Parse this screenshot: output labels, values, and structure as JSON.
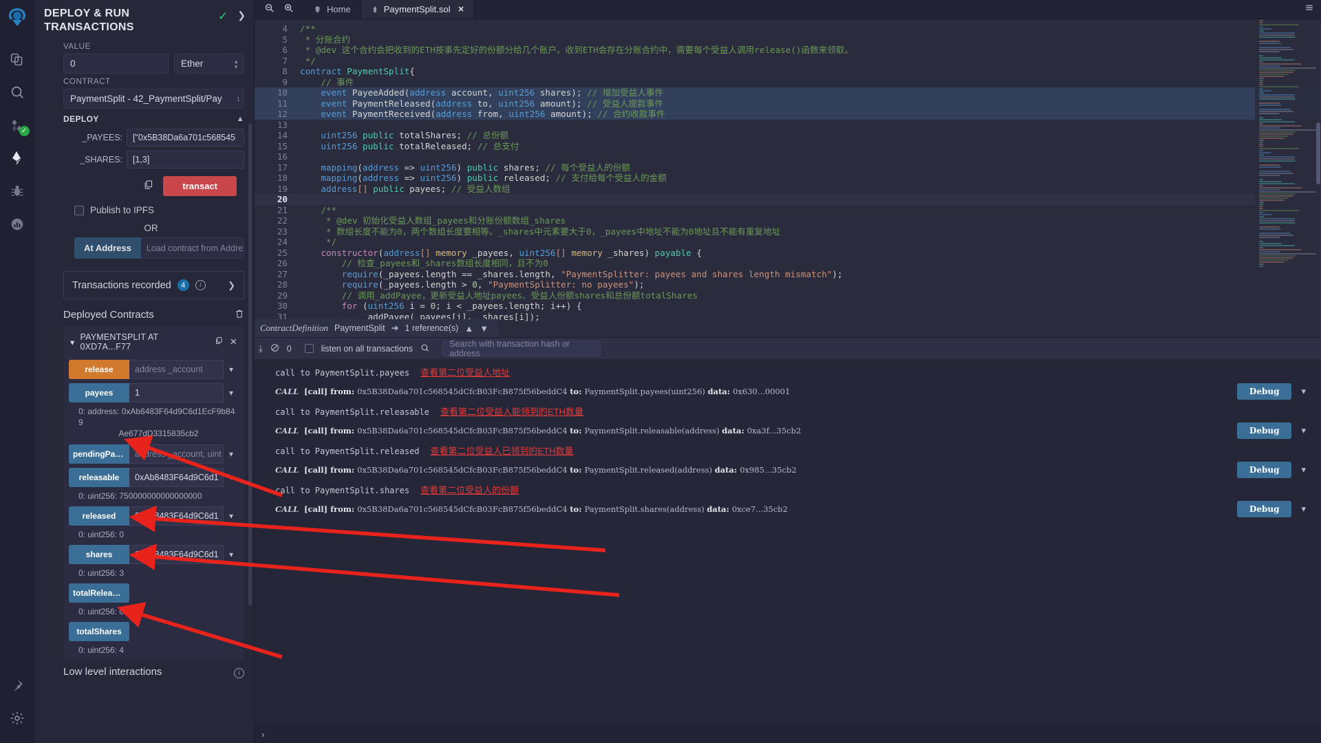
{
  "rail": {
    "logo": "remix-logo-icon",
    "items": [
      {
        "name": "file-explorer-icon"
      },
      {
        "name": "search-icon"
      },
      {
        "name": "solidity-compiler-icon",
        "badge": "✓"
      },
      {
        "name": "deploy-run-icon"
      },
      {
        "name": "debugger-icon"
      },
      {
        "name": "plugin-manager-icon"
      }
    ],
    "bottom": [
      {
        "name": "pin-icon"
      },
      {
        "name": "settings-gear-icon"
      }
    ]
  },
  "panel": {
    "title": "DEPLOY & RUN TRANSACTIONS",
    "value_label": "VALUE",
    "value": "0",
    "unit": "Ether",
    "contract_label": "CONTRACT",
    "contract": "PaymentSplit - 42_PaymentSplit/Pay",
    "deploy_label": "DEPLOY",
    "args": [
      {
        "label": "_PAYEES:",
        "value": "[\"0x5B38Da6a701c568545"
      },
      {
        "label": "_SHARES:",
        "value": "[1,3]"
      }
    ],
    "transact_label": "transact",
    "publish_ipfs": "Publish to IPFS",
    "or": "OR",
    "at_address_label": "At Address",
    "at_address_placeholder": "Load contract from Addre",
    "transactions_recorded": "Transactions recorded",
    "transactions_count": "4",
    "deployed_contracts": "Deployed Contracts",
    "contract_instance": "PAYMENTSPLIT AT 0XD7A...F77",
    "functions": [
      {
        "name": "release",
        "color": "orange",
        "input": "address _account",
        "placeholder": true,
        "output": null
      },
      {
        "name": "payees",
        "color": "blue",
        "input": "1",
        "placeholder": false,
        "output": "0:  address: 0xAb8483F64d9C6d1EcF9b849\nAe677dD3315835cb2"
      },
      {
        "name": "pendingPay...",
        "color": "blue",
        "input": "address _account, uint",
        "placeholder": true,
        "output": null
      },
      {
        "name": "releasable",
        "color": "blue",
        "input": "0xAb8483F64d9C6d1",
        "placeholder": false,
        "output": "0: uint256: 750000000000000000"
      },
      {
        "name": "released",
        "color": "blue",
        "input": "0xAb8483F64d9C6d1",
        "placeholder": false,
        "output": "0: uint256: 0"
      },
      {
        "name": "shares",
        "color": "blue",
        "input": "0xAb8483F64d9C6d1",
        "placeholder": false,
        "output": "0: uint256: 3"
      },
      {
        "name": "totalReleased",
        "color": "blue",
        "input": null,
        "placeholder": false,
        "output": "0: uint256: 0"
      },
      {
        "name": "totalShares",
        "color": "blue",
        "input": null,
        "placeholder": false,
        "output": "0: uint256: 4"
      }
    ],
    "low_level": "Low level interactions"
  },
  "tabbar": {
    "zoom_out": "zoom-out-icon",
    "zoom_in": "zoom-in-icon",
    "tabs": [
      {
        "label": "Home",
        "icon": "remix-home-icon",
        "active": false,
        "closable": false
      },
      {
        "label": "PaymentSplit.sol",
        "icon": "solidity-file-icon",
        "active": true,
        "closable": true
      }
    ]
  },
  "editor": {
    "lines": [
      {
        "n": 4,
        "tokens": [
          {
            "t": "/**",
            "c": "k-com"
          }
        ]
      },
      {
        "n": 5,
        "tokens": [
          {
            "t": " * 分账合约",
            "c": "k-com"
          }
        ]
      },
      {
        "n": 6,
        "tokens": [
          {
            "t": " * @dev 这个合约会把收到的ETH按事先定好的份额分给几个账户。收到ETH会存在分账合约中，需要每个受益人调用release()函数来领取。",
            "c": "k-com"
          }
        ]
      },
      {
        "n": 7,
        "tokens": [
          {
            "t": " */",
            "c": "k-com"
          }
        ]
      },
      {
        "n": 8,
        "tokens": [
          {
            "t": "contract ",
            "c": "k-kw"
          },
          {
            "t": "PaymentSplit",
            "c": "k-ty"
          },
          {
            "t": "{",
            "c": "k-pl"
          }
        ]
      },
      {
        "n": 9,
        "tokens": [
          {
            "t": "    // 事件",
            "c": "k-com"
          }
        ]
      },
      {
        "n": 10,
        "tokens": [
          {
            "t": "    ",
            "c": "k-pl"
          },
          {
            "t": "event ",
            "c": "k-kw"
          },
          {
            "t": "PayeeAdded",
            "c": "k-pl"
          },
          {
            "t": "(",
            "c": "k-pl"
          },
          {
            "t": "address",
            "c": "k-kw"
          },
          {
            "t": " account, ",
            "c": "k-pl"
          },
          {
            "t": "uint256",
            "c": "k-kw"
          },
          {
            "t": " shares); ",
            "c": "k-pl"
          },
          {
            "t": "// 增加受益人事件",
            "c": "k-com"
          }
        ],
        "hl": true
      },
      {
        "n": 11,
        "tokens": [
          {
            "t": "    ",
            "c": "k-pl"
          },
          {
            "t": "event ",
            "c": "k-kw"
          },
          {
            "t": "PaymentReleased",
            "c": "k-pl"
          },
          {
            "t": "(",
            "c": "k-pl"
          },
          {
            "t": "address",
            "c": "k-kw"
          },
          {
            "t": " to, ",
            "c": "k-pl"
          },
          {
            "t": "uint256",
            "c": "k-kw"
          },
          {
            "t": " amount); ",
            "c": "k-pl"
          },
          {
            "t": "// 受益人提款事件",
            "c": "k-com"
          }
        ],
        "hl": true
      },
      {
        "n": 12,
        "tokens": [
          {
            "t": "    ",
            "c": "k-pl"
          },
          {
            "t": "event ",
            "c": "k-kw"
          },
          {
            "t": "PaymentReceived",
            "c": "k-pl"
          },
          {
            "t": "(",
            "c": "k-pl"
          },
          {
            "t": "address",
            "c": "k-kw"
          },
          {
            "t": " from, ",
            "c": "k-pl"
          },
          {
            "t": "uint256",
            "c": "k-kw"
          },
          {
            "t": " amount); ",
            "c": "k-pl"
          },
          {
            "t": "// 合约收款事件",
            "c": "k-com"
          }
        ],
        "hl": true
      },
      {
        "n": 13,
        "tokens": []
      },
      {
        "n": 14,
        "tokens": [
          {
            "t": "    ",
            "c": "k-pl"
          },
          {
            "t": "uint256",
            "c": "k-kw"
          },
          {
            "t": " ",
            "c": "k-pl"
          },
          {
            "t": "public",
            "c": "k-ty"
          },
          {
            "t": " totalShares; ",
            "c": "k-pl"
          },
          {
            "t": "// 总份额",
            "c": "k-com"
          }
        ]
      },
      {
        "n": 15,
        "tokens": [
          {
            "t": "    ",
            "c": "k-pl"
          },
          {
            "t": "uint256",
            "c": "k-kw"
          },
          {
            "t": " ",
            "c": "k-pl"
          },
          {
            "t": "public",
            "c": "k-ty"
          },
          {
            "t": " totalReleased; ",
            "c": "k-pl"
          },
          {
            "t": "// 总支付",
            "c": "k-com"
          }
        ]
      },
      {
        "n": 16,
        "tokens": []
      },
      {
        "n": 17,
        "tokens": [
          {
            "t": "    ",
            "c": "k-pl"
          },
          {
            "t": "mapping",
            "c": "k-kw"
          },
          {
            "t": "(",
            "c": "k-pl"
          },
          {
            "t": "address",
            "c": "k-kw"
          },
          {
            "t": " => ",
            "c": "k-pl"
          },
          {
            "t": "uint256",
            "c": "k-kw"
          },
          {
            "t": ") ",
            "c": "k-pl"
          },
          {
            "t": "public",
            "c": "k-ty"
          },
          {
            "t": " shares; ",
            "c": "k-pl"
          },
          {
            "t": "// 每个受益人的份额",
            "c": "k-com"
          }
        ]
      },
      {
        "n": 18,
        "tokens": [
          {
            "t": "    ",
            "c": "k-pl"
          },
          {
            "t": "mapping",
            "c": "k-kw"
          },
          {
            "t": "(",
            "c": "k-pl"
          },
          {
            "t": "address",
            "c": "k-kw"
          },
          {
            "t": " => ",
            "c": "k-pl"
          },
          {
            "t": "uint256",
            "c": "k-kw"
          },
          {
            "t": ") ",
            "c": "k-pl"
          },
          {
            "t": "public",
            "c": "k-ty"
          },
          {
            "t": " released; ",
            "c": "k-pl"
          },
          {
            "t": "// 支付给每个受益人的金额",
            "c": "k-com"
          }
        ]
      },
      {
        "n": 19,
        "tokens": [
          {
            "t": "    ",
            "c": "k-pl"
          },
          {
            "t": "address",
            "c": "k-kw"
          },
          {
            "t": "[] ",
            "c": "k-or"
          },
          {
            "t": "public",
            "c": "k-ty"
          },
          {
            "t": " payees; ",
            "c": "k-pl"
          },
          {
            "t": "// 受益人数组",
            "c": "k-com"
          }
        ]
      },
      {
        "n": 20,
        "tokens": [],
        "cur": true
      },
      {
        "n": 21,
        "tokens": [
          {
            "t": "    /**",
            "c": "k-com"
          }
        ]
      },
      {
        "n": 22,
        "tokens": [
          {
            "t": "     * @dev 初始化受益人数组_payees和分账份额数组_shares",
            "c": "k-com"
          }
        ]
      },
      {
        "n": 23,
        "tokens": [
          {
            "t": "     * 数组长度不能为0，两个数组长度要相等。_shares中元素要大于0，_payees中地址不能为0地址且不能有重复地址",
            "c": "k-com"
          }
        ]
      },
      {
        "n": 24,
        "tokens": [
          {
            "t": "     */",
            "c": "k-com"
          }
        ]
      },
      {
        "n": 25,
        "tokens": [
          {
            "t": "    ",
            "c": "k-pl"
          },
          {
            "t": "constructor",
            "c": "k-kw2"
          },
          {
            "t": "(",
            "c": "k-pl"
          },
          {
            "t": "address",
            "c": "k-kw"
          },
          {
            "t": "[] ",
            "c": "k-or"
          },
          {
            "t": "memory",
            "c": "k-gold"
          },
          {
            "t": " _payees, ",
            "c": "k-pl"
          },
          {
            "t": "uint256",
            "c": "k-kw"
          },
          {
            "t": "[] ",
            "c": "k-or"
          },
          {
            "t": "memory",
            "c": "k-gold"
          },
          {
            "t": " _shares) ",
            "c": "k-pl"
          },
          {
            "t": "payable",
            "c": "k-ty"
          },
          {
            "t": " {",
            "c": "k-pl"
          }
        ]
      },
      {
        "n": 26,
        "tokens": [
          {
            "t": "        // 检查_payees和_shares数组长度相同，且不为0",
            "c": "k-com"
          }
        ]
      },
      {
        "n": 27,
        "tokens": [
          {
            "t": "        ",
            "c": "k-pl"
          },
          {
            "t": "require",
            "c": "k-kw"
          },
          {
            "t": "(_payees.length == _shares.length, ",
            "c": "k-pl"
          },
          {
            "t": "\"PaymentSplitter: payees and shares length mismatch\"",
            "c": "k-str"
          },
          {
            "t": ");",
            "c": "k-pl"
          }
        ]
      },
      {
        "n": 28,
        "tokens": [
          {
            "t": "        ",
            "c": "k-pl"
          },
          {
            "t": "require",
            "c": "k-kw"
          },
          {
            "t": "(_payees.length > ",
            "c": "k-pl"
          },
          {
            "t": "0",
            "c": "k-num"
          },
          {
            "t": ", ",
            "c": "k-pl"
          },
          {
            "t": "\"PaymentSplitter: no payees\"",
            "c": "k-str"
          },
          {
            "t": ");",
            "c": "k-pl"
          }
        ]
      },
      {
        "n": 29,
        "tokens": [
          {
            "t": "        // 调用_addPayee，更新受益人地址payees、受益人份额shares和总份额totalShares",
            "c": "k-com"
          }
        ]
      },
      {
        "n": 30,
        "tokens": [
          {
            "t": "        ",
            "c": "k-pl"
          },
          {
            "t": "for",
            "c": "k-kw2"
          },
          {
            "t": " (",
            "c": "k-pl"
          },
          {
            "t": "uint256",
            "c": "k-kw"
          },
          {
            "t": " i = ",
            "c": "k-pl"
          },
          {
            "t": "0",
            "c": "k-num"
          },
          {
            "t": "; i < _payees.length; i++) {",
            "c": "k-pl"
          }
        ]
      },
      {
        "n": 31,
        "tokens": [
          {
            "t": "            _addPayee(_payees[i], _shares[i]);",
            "c": "k-pl"
          }
        ]
      },
      {
        "n": 32,
        "tokens": [
          {
            "t": "        }",
            "c": "k-pl"
          }
        ]
      },
      {
        "n": 33,
        "tokens": [
          {
            "t": "    }",
            "c": "k-pl"
          }
        ]
      }
    ],
    "breadcrumb": {
      "kind": "ContractDefinition",
      "name": "PaymentSplit",
      "references": "1 reference(s)"
    }
  },
  "terminal": {
    "counter": "0",
    "listen_label": "listen on all transactions",
    "search_placeholder": "Search with transaction hash or address",
    "entries": [
      {
        "note": "call to PaymentSplit.payees",
        "note_zh": "查看第二位受益人地址",
        "tag": "CALL",
        "kind": "[call]",
        "from_label": "from:",
        "from": "0x5B38Da6a701c568545dCfcB03FcB875f56beddC4",
        "to_label": "to:",
        "to": "PaymentSplit.payees(uint256)",
        "data_label": "data:",
        "data": "0x630...00001",
        "debug": "Debug"
      },
      {
        "note": "call to PaymentSplit.releasable",
        "note_zh": "查看第二位受益人能领到的ETH数量",
        "tag": "CALL",
        "kind": "[call]",
        "from_label": "from:",
        "from": "0x5B38Da6a701c568545dCfcB03FcB875f56beddC4",
        "to_label": "to:",
        "to": "PaymentSplit.releasable(address)",
        "data_label": "data:",
        "data": "0xa3f...35cb2",
        "debug": "Debug"
      },
      {
        "note": "call to PaymentSplit.released",
        "note_zh": "查看第二位受益人已领到的ETH数量",
        "tag": "CALL",
        "kind": "[call]",
        "from_label": "from:",
        "from": "0x5B38Da6a701c568545dCfcB03FcB875f56beddC4",
        "to_label": "to:",
        "to": "PaymentSplit.released(address)",
        "data_label": "data:",
        "data": "0x985...35cb2",
        "debug": "Debug"
      },
      {
        "note": "call to PaymentSplit.shares",
        "note_zh": "查看第二位受益人的份额",
        "tag": "CALL",
        "kind": "[call]",
        "from_label": "from:",
        "from": "0x5B38Da6a701c568545dCfcB03FcB875f56beddC4",
        "to_label": "to:",
        "to": "PaymentSplit.shares(address)",
        "data_label": "data:",
        "data": "0xce7...35cb2",
        "debug": "Debug"
      }
    ]
  },
  "statusbar": {
    "expand": "›"
  },
  "colors": {
    "accent_blue": "#3b6e96",
    "orange": "#d1792d",
    "red": "#c9464b",
    "annotation_red": "#e23b3b",
    "green": "#28a745"
  }
}
